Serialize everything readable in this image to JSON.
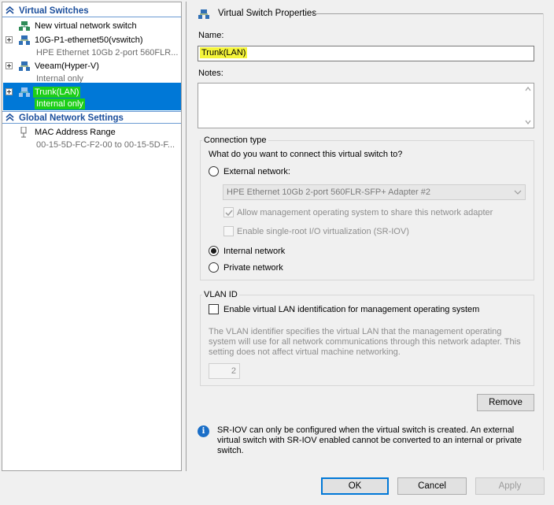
{
  "tree": {
    "virtual_switches_header": "Virtual Switches",
    "items": [
      {
        "label": "New virtual network switch",
        "sub": ""
      },
      {
        "label": "10G-P1-ethernet50(vswitch)",
        "sub": "HPE Ethernet 10Gb 2-port 560FLR..."
      },
      {
        "label": "Veeam(Hyper-V)",
        "sub": "Internal only"
      },
      {
        "label": "Trunk(LAN)",
        "sub": "Internal only"
      }
    ],
    "global_header": "Global Network Settings",
    "mac": {
      "label": "MAC Address Range",
      "sub": "00-15-5D-FC-F2-00 to 00-15-5D-F..."
    }
  },
  "props": {
    "title": "Virtual Switch Properties",
    "name_label": "Name:",
    "name_value": "Trunk(LAN)",
    "notes_label": "Notes:",
    "connection": {
      "group_title": "Connection type",
      "question": "What do you want to connect this virtual switch to?",
      "external_label": "External network:",
      "adapter_value": "HPE Ethernet 10Gb 2-port 560FLR-SFP+ Adapter #2",
      "allow_mgmt_label": "Allow management operating system to share this network adapter",
      "sriov_label": "Enable single-root I/O virtualization (SR-IOV)",
      "internal_label": "Internal network",
      "private_label": "Private network",
      "selected": "internal"
    },
    "vlan": {
      "group_title": "VLAN ID",
      "enable_label": "Enable virtual LAN identification for management operating system",
      "description": "The VLAN identifier specifies the virtual LAN that the management operating system will use for all network communications through this network adapter. This setting does not affect virtual machine networking.",
      "value": "2"
    },
    "remove_label": "Remove",
    "info_text": "SR-IOV can only be configured when the virtual switch is created. An external virtual switch with SR-IOV enabled cannot be converted to an internal or private switch."
  },
  "buttons": {
    "ok": "OK",
    "cancel": "Cancel",
    "apply": "Apply"
  },
  "colors": {
    "selection": "#0078d7",
    "section_header": "#1c4f9c",
    "name_highlight": "#f5f53a",
    "trunk_highlight": "#1ccf17"
  }
}
